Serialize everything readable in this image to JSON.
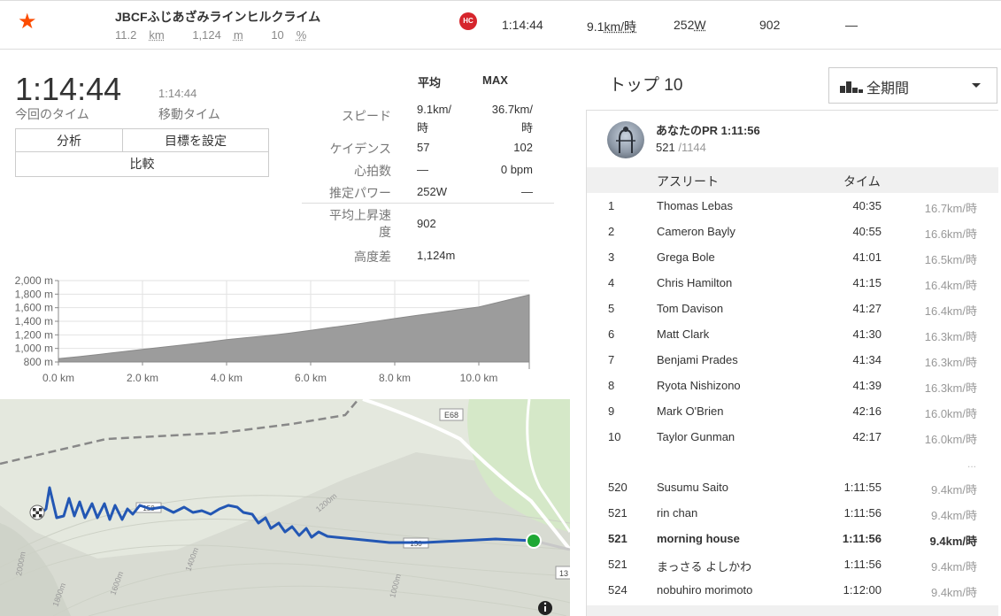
{
  "segment": {
    "name": "JBCFふじあざみラインヒルクライム",
    "distance": "11.2",
    "distance_unit": "km",
    "elevation": "1,124",
    "elevation_unit": "m",
    "grade": "10",
    "grade_unit": "%",
    "category": "HC",
    "time": "1:14:44",
    "speed": "9.1",
    "speed_unit": "km/時",
    "power": "252",
    "power_unit": "W",
    "vam": "902",
    "hr": "—"
  },
  "effort": {
    "elapsed_time": "1:14:44",
    "elapsed_label": "今回のタイム",
    "moving_time": "1:14:44",
    "moving_label": "移動タイム",
    "buttons": {
      "analysis": "分析",
      "set_goal": "目標を設定",
      "compare": "比較"
    }
  },
  "stats": {
    "col_avg": "平均",
    "col_max": "MAX",
    "rows": [
      {
        "label": "スピード",
        "avg": "9.1km/時",
        "max": "36.7km/時"
      },
      {
        "label": "ケイデンス",
        "avg": "57",
        "max": "102"
      },
      {
        "label": "心拍数",
        "avg": "—",
        "max": "0 bpm"
      },
      {
        "label": "推定パワー",
        "avg": "252W",
        "max": "—"
      }
    ],
    "extra": [
      {
        "label": "平均上昇速度",
        "value": "902"
      },
      {
        "label": "高度差",
        "value": "1,124m"
      }
    ]
  },
  "chart_data": {
    "type": "area",
    "x": [
      0,
      0.5,
      1,
      1.5,
      2,
      2.5,
      3,
      3.5,
      4,
      4.5,
      5,
      5.5,
      6,
      6.5,
      7,
      7.5,
      8,
      8.5,
      9,
      9.5,
      10,
      10.5,
      11,
      11.2
    ],
    "values": [
      850,
      880,
      915,
      950,
      985,
      1020,
      1055,
      1090,
      1130,
      1160,
      1190,
      1225,
      1265,
      1310,
      1350,
      1395,
      1440,
      1485,
      1525,
      1570,
      1610,
      1685,
      1760,
      1790
    ],
    "xlabel": "",
    "ylabel": "",
    "xticks": [
      "0.0 km",
      "2.0 km",
      "4.0 km",
      "6.0 km",
      "8.0 km",
      "10.0 km"
    ],
    "yticks": [
      "800 m",
      "1,000 m",
      "1,200 m",
      "1,400 m",
      "1,600 m",
      "1,800 m",
      "2,000 m"
    ],
    "xlim": [
      0,
      11.2
    ],
    "ylim": [
      800,
      2000
    ],
    "grid": true,
    "color": "#9c9c9c"
  },
  "map": {
    "labels": [
      "E68",
      "1200m",
      "1400m",
      "1600m",
      "1800m",
      "2000m",
      "1000m",
      "150",
      "150",
      "13"
    ],
    "route_color": "#1e56a8",
    "start_color": "#1fa834",
    "info_icon": "info-icon"
  },
  "leaderboard": {
    "title": "トップ 10",
    "filter": "全期間",
    "pr_title": "あなたのPR 1:11:56",
    "pr_rank": "521",
    "pr_total": "/1144",
    "col_athlete": "アスリート",
    "col_time": "タイム",
    "top": [
      {
        "rank": "1",
        "name": "Thomas Lebas",
        "time": "40:35",
        "speed": "16.7km/時"
      },
      {
        "rank": "2",
        "name": "Cameron Bayly",
        "time": "40:55",
        "speed": "16.6km/時"
      },
      {
        "rank": "3",
        "name": "Grega Bole",
        "time": "41:01",
        "speed": "16.5km/時"
      },
      {
        "rank": "4",
        "name": "Chris Hamilton",
        "time": "41:15",
        "speed": "16.4km/時"
      },
      {
        "rank": "5",
        "name": "Tom Davison",
        "time": "41:27",
        "speed": "16.4km/時"
      },
      {
        "rank": "6",
        "name": "Matt Clark",
        "time": "41:30",
        "speed": "16.3km/時"
      },
      {
        "rank": "7",
        "name": "Benjami Prades",
        "time": "41:34",
        "speed": "16.3km/時"
      },
      {
        "rank": "8",
        "name": "Ryota Nishizono",
        "time": "41:39",
        "speed": "16.3km/時"
      },
      {
        "rank": "9",
        "name": "Mark O'Brien",
        "time": "42:16",
        "speed": "16.0km/時"
      },
      {
        "rank": "10",
        "name": "Taylor Gunman",
        "time": "42:17",
        "speed": "16.0km/時"
      }
    ],
    "ellipsis": "...",
    "nearby": [
      {
        "rank": "520",
        "name": "Susumu Saito",
        "time": "1:11:55",
        "speed": "9.4km/時",
        "bold": false
      },
      {
        "rank": "521",
        "name": "rin chan",
        "time": "1:11:56",
        "speed": "9.4km/時",
        "bold": false
      },
      {
        "rank": "521",
        "name": "morning house",
        "time": "1:11:56",
        "speed": "9.4km/時",
        "bold": true
      },
      {
        "rank": "521",
        "name": "まっさる よしかわ",
        "time": "1:11:56",
        "speed": "9.4km/時",
        "bold": false
      },
      {
        "rank": "524",
        "name": "nobuhiro morimoto",
        "time": "1:12:00",
        "speed": "9.4km/時",
        "bold": false
      }
    ]
  }
}
